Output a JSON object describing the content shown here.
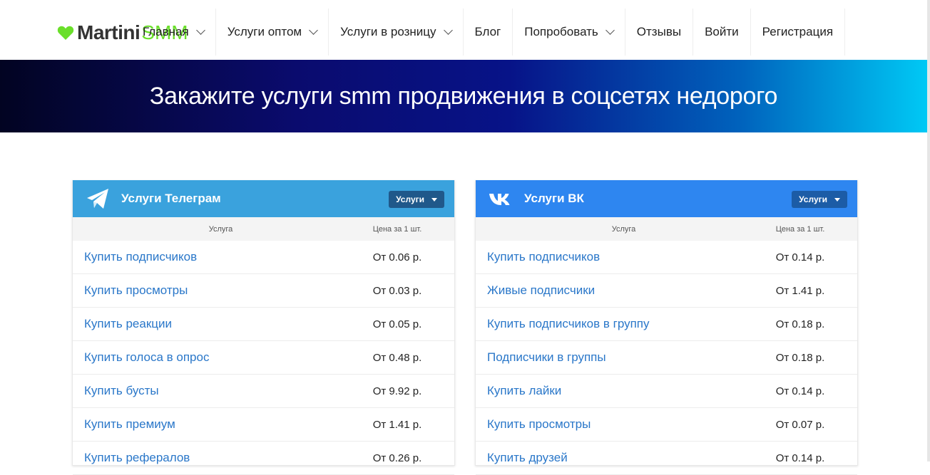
{
  "logo": {
    "part1": "Martini",
    "part2": "SMM"
  },
  "nav": [
    {
      "label": "Главная",
      "dropdown": true
    },
    {
      "label": "Услуги оптом",
      "dropdown": true
    },
    {
      "label": "Услуги в розницу",
      "dropdown": true
    },
    {
      "label": "Блог",
      "dropdown": false
    },
    {
      "label": "Попробовать",
      "dropdown": true
    },
    {
      "label": "Отзывы",
      "dropdown": false
    },
    {
      "label": "Войти",
      "dropdown": false
    },
    {
      "label": "Регистрация",
      "dropdown": false
    }
  ],
  "banner": {
    "title": "Закажите услуги smm продвижения в соцсетях недорого"
  },
  "telegram": {
    "title": "Услуги Телеграм",
    "button": "Услуги",
    "col_service": "Услуга",
    "col_price": "Цена за 1 шт.",
    "rows": [
      {
        "name": "Купить подписчиков",
        "price": "От 0.06 р."
      },
      {
        "name": "Купить просмотры",
        "price": "От 0.03 р."
      },
      {
        "name": "Купить реакции",
        "price": "От 0.05 р."
      },
      {
        "name": "Купить голоса в опрос",
        "price": "От 0.48 р."
      },
      {
        "name": "Купить бусты",
        "price": "От 9.92 р."
      },
      {
        "name": "Купить премиум",
        "price": "От 1.41 р."
      },
      {
        "name": "Купить рефералов",
        "price": "От 0.26 р."
      }
    ]
  },
  "vk": {
    "title": "Услуги ВК",
    "button": "Услуги",
    "col_service": "Услуга",
    "col_price": "Цена за 1 шт.",
    "rows": [
      {
        "name": "Купить подписчиков",
        "price": "От 0.14 р."
      },
      {
        "name": "Живые подписчики",
        "price": "От 1.41 р."
      },
      {
        "name": "Купить подписчиков в группу",
        "price": "От 0.18 р."
      },
      {
        "name": "Подписчики в группы",
        "price": "От 0.18 р."
      },
      {
        "name": "Купить лайки",
        "price": "От 0.14 р."
      },
      {
        "name": "Купить просмотры",
        "price": "От 0.07 р."
      },
      {
        "name": "Купить друзей",
        "price": "От 0.14 р."
      }
    ]
  },
  "colors": {
    "accent_green": "#6adf2a",
    "telegram_blue": "#3aa2dd",
    "vk_blue": "#2e86f0",
    "link_blue": "#2a77c9"
  },
  "icons": [
    "heart-icon",
    "telegram-plane-icon",
    "vk-logo-icon",
    "chevron-down-icon",
    "caret-down-icon"
  ]
}
